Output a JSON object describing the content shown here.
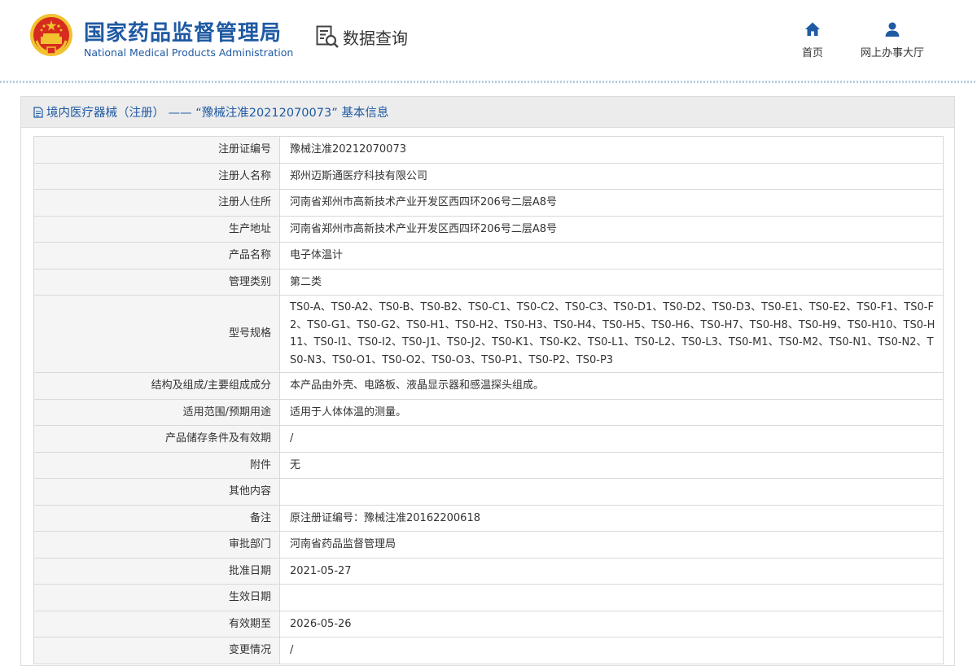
{
  "header": {
    "org_name_cn": "国家药品监督管理局",
    "org_name_en": "National Medical Products Administration",
    "section_title": "数据查询",
    "nav": [
      {
        "label": "首页",
        "icon": "home-icon"
      },
      {
        "label": "网上办事大厅",
        "icon": "user-icon"
      }
    ]
  },
  "panel": {
    "title": "境内医疗器械（注册） ——  “豫械注准20212070073” 基本信息",
    "rows": [
      {
        "label": "注册证编号",
        "value": "豫械注准20212070073"
      },
      {
        "label": "注册人名称",
        "value": "郑州迈斯通医疗科技有限公司"
      },
      {
        "label": "注册人住所",
        "value": "河南省郑州市高新技术产业开发区西四环206号二层A8号"
      },
      {
        "label": "生产地址",
        "value": "河南省郑州市高新技术产业开发区西四环206号二层A8号"
      },
      {
        "label": "产品名称",
        "value": "电子体温计"
      },
      {
        "label": "管理类别",
        "value": "第二类"
      },
      {
        "label": "型号规格",
        "value": "TS0-A、TS0-A2、TS0-B、TS0-B2、TS0-C1、TS0-C2、TS0-C3、TS0-D1、TS0-D2、TS0-D3、TS0-E1、TS0-E2、TS0-F1、TS0-F2、TS0-G1、TS0-G2、TS0-H1、TS0-H2、TS0-H3、TS0-H4、TS0-H5、TS0-H6、TS0-H7、TS0-H8、TS0-H9、TS0-H10、TS0-H11、TS0-I1、TS0-I2、TS0-J1、TS0-J2、TS0-K1、TS0-K2、TS0-L1、TS0-L2、TS0-L3、TS0-M1、TS0-M2、TS0-N1、TS0-N2、TS0-N3、TS0-O1、TS0-O2、TS0-O3、TS0-P1、TS0-P2、TS0-P3"
      },
      {
        "label": "结构及组成/主要组成成分",
        "value": "本产品由外壳、电路板、液晶显示器和感温探头组成。"
      },
      {
        "label": "适用范围/预期用途",
        "value": "适用于人体体温的测量。"
      },
      {
        "label": "产品储存条件及有效期",
        "value": "/"
      },
      {
        "label": "附件",
        "value": "无"
      },
      {
        "label": "其他内容",
        "value": ""
      },
      {
        "label": "备注",
        "value": "原注册证编号：豫械注准20162200618"
      },
      {
        "label": "审批部门",
        "value": "河南省药品监督管理局"
      },
      {
        "label": "批准日期",
        "value": "2021-05-27"
      },
      {
        "label": "生效日期",
        "value": ""
      },
      {
        "label": "有效期至",
        "value": "2026-05-26"
      },
      {
        "label": "变更情况",
        "value": "/"
      }
    ]
  },
  "colors": {
    "brand_blue": "#1f5aa3",
    "label_bg": "#f5f5f5",
    "title_bar_bg": "#ececec"
  }
}
